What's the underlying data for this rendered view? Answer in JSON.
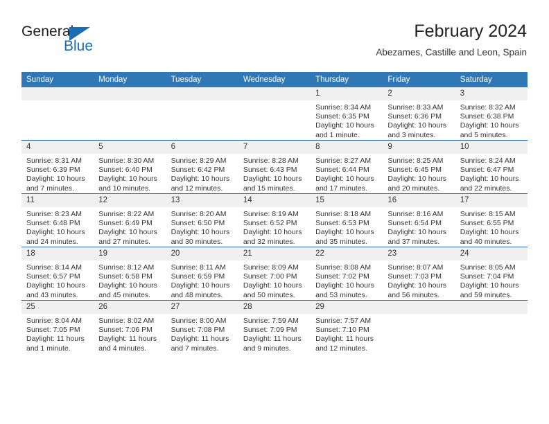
{
  "brand": {
    "name_part1": "General",
    "name_part2": "Blue",
    "accent_color": "#1a6cb5"
  },
  "header": {
    "title": "February 2024",
    "subtitle": "Abezames, Castille and Leon, Spain"
  },
  "theme": {
    "header_row_color": "#3077b5",
    "row_divider_color": "#2e6da4",
    "daynum_band_color": "#f0f0f0"
  },
  "weekday_headers": [
    "Sunday",
    "Monday",
    "Tuesday",
    "Wednesday",
    "Thursday",
    "Friday",
    "Saturday"
  ],
  "weeks": [
    [
      {
        "day": "",
        "blank": true
      },
      {
        "day": "",
        "blank": true
      },
      {
        "day": "",
        "blank": true
      },
      {
        "day": "",
        "blank": true
      },
      {
        "day": "1",
        "sunrise": "Sunrise: 8:34 AM",
        "sunset": "Sunset: 6:35 PM",
        "daylight": "Daylight: 10 hours and 1 minute."
      },
      {
        "day": "2",
        "sunrise": "Sunrise: 8:33 AM",
        "sunset": "Sunset: 6:36 PM",
        "daylight": "Daylight: 10 hours and 3 minutes."
      },
      {
        "day": "3",
        "sunrise": "Sunrise: 8:32 AM",
        "sunset": "Sunset: 6:38 PM",
        "daylight": "Daylight: 10 hours and 5 minutes."
      }
    ],
    [
      {
        "day": "4",
        "sunrise": "Sunrise: 8:31 AM",
        "sunset": "Sunset: 6:39 PM",
        "daylight": "Daylight: 10 hours and 7 minutes."
      },
      {
        "day": "5",
        "sunrise": "Sunrise: 8:30 AM",
        "sunset": "Sunset: 6:40 PM",
        "daylight": "Daylight: 10 hours and 10 minutes."
      },
      {
        "day": "6",
        "sunrise": "Sunrise: 8:29 AM",
        "sunset": "Sunset: 6:42 PM",
        "daylight": "Daylight: 10 hours and 12 minutes."
      },
      {
        "day": "7",
        "sunrise": "Sunrise: 8:28 AM",
        "sunset": "Sunset: 6:43 PM",
        "daylight": "Daylight: 10 hours and 15 minutes."
      },
      {
        "day": "8",
        "sunrise": "Sunrise: 8:27 AM",
        "sunset": "Sunset: 6:44 PM",
        "daylight": "Daylight: 10 hours and 17 minutes."
      },
      {
        "day": "9",
        "sunrise": "Sunrise: 8:25 AM",
        "sunset": "Sunset: 6:45 PM",
        "daylight": "Daylight: 10 hours and 20 minutes."
      },
      {
        "day": "10",
        "sunrise": "Sunrise: 8:24 AM",
        "sunset": "Sunset: 6:47 PM",
        "daylight": "Daylight: 10 hours and 22 minutes."
      }
    ],
    [
      {
        "day": "11",
        "sunrise": "Sunrise: 8:23 AM",
        "sunset": "Sunset: 6:48 PM",
        "daylight": "Daylight: 10 hours and 24 minutes."
      },
      {
        "day": "12",
        "sunrise": "Sunrise: 8:22 AM",
        "sunset": "Sunset: 6:49 PM",
        "daylight": "Daylight: 10 hours and 27 minutes."
      },
      {
        "day": "13",
        "sunrise": "Sunrise: 8:20 AM",
        "sunset": "Sunset: 6:50 PM",
        "daylight": "Daylight: 10 hours and 30 minutes."
      },
      {
        "day": "14",
        "sunrise": "Sunrise: 8:19 AM",
        "sunset": "Sunset: 6:52 PM",
        "daylight": "Daylight: 10 hours and 32 minutes."
      },
      {
        "day": "15",
        "sunrise": "Sunrise: 8:18 AM",
        "sunset": "Sunset: 6:53 PM",
        "daylight": "Daylight: 10 hours and 35 minutes."
      },
      {
        "day": "16",
        "sunrise": "Sunrise: 8:16 AM",
        "sunset": "Sunset: 6:54 PM",
        "daylight": "Daylight: 10 hours and 37 minutes."
      },
      {
        "day": "17",
        "sunrise": "Sunrise: 8:15 AM",
        "sunset": "Sunset: 6:55 PM",
        "daylight": "Daylight: 10 hours and 40 minutes."
      }
    ],
    [
      {
        "day": "18",
        "sunrise": "Sunrise: 8:14 AM",
        "sunset": "Sunset: 6:57 PM",
        "daylight": "Daylight: 10 hours and 43 minutes."
      },
      {
        "day": "19",
        "sunrise": "Sunrise: 8:12 AM",
        "sunset": "Sunset: 6:58 PM",
        "daylight": "Daylight: 10 hours and 45 minutes."
      },
      {
        "day": "20",
        "sunrise": "Sunrise: 8:11 AM",
        "sunset": "Sunset: 6:59 PM",
        "daylight": "Daylight: 10 hours and 48 minutes."
      },
      {
        "day": "21",
        "sunrise": "Sunrise: 8:09 AM",
        "sunset": "Sunset: 7:00 PM",
        "daylight": "Daylight: 10 hours and 50 minutes."
      },
      {
        "day": "22",
        "sunrise": "Sunrise: 8:08 AM",
        "sunset": "Sunset: 7:02 PM",
        "daylight": "Daylight: 10 hours and 53 minutes."
      },
      {
        "day": "23",
        "sunrise": "Sunrise: 8:07 AM",
        "sunset": "Sunset: 7:03 PM",
        "daylight": "Daylight: 10 hours and 56 minutes."
      },
      {
        "day": "24",
        "sunrise": "Sunrise: 8:05 AM",
        "sunset": "Sunset: 7:04 PM",
        "daylight": "Daylight: 10 hours and 59 minutes."
      }
    ],
    [
      {
        "day": "25",
        "sunrise": "Sunrise: 8:04 AM",
        "sunset": "Sunset: 7:05 PM",
        "daylight": "Daylight: 11 hours and 1 minute."
      },
      {
        "day": "26",
        "sunrise": "Sunrise: 8:02 AM",
        "sunset": "Sunset: 7:06 PM",
        "daylight": "Daylight: 11 hours and 4 minutes."
      },
      {
        "day": "27",
        "sunrise": "Sunrise: 8:00 AM",
        "sunset": "Sunset: 7:08 PM",
        "daylight": "Daylight: 11 hours and 7 minutes."
      },
      {
        "day": "28",
        "sunrise": "Sunrise: 7:59 AM",
        "sunset": "Sunset: 7:09 PM",
        "daylight": "Daylight: 11 hours and 9 minutes."
      },
      {
        "day": "29",
        "sunrise": "Sunrise: 7:57 AM",
        "sunset": "Sunset: 7:10 PM",
        "daylight": "Daylight: 11 hours and 12 minutes."
      },
      {
        "day": "",
        "blank": true
      },
      {
        "day": "",
        "blank": true
      }
    ]
  ]
}
